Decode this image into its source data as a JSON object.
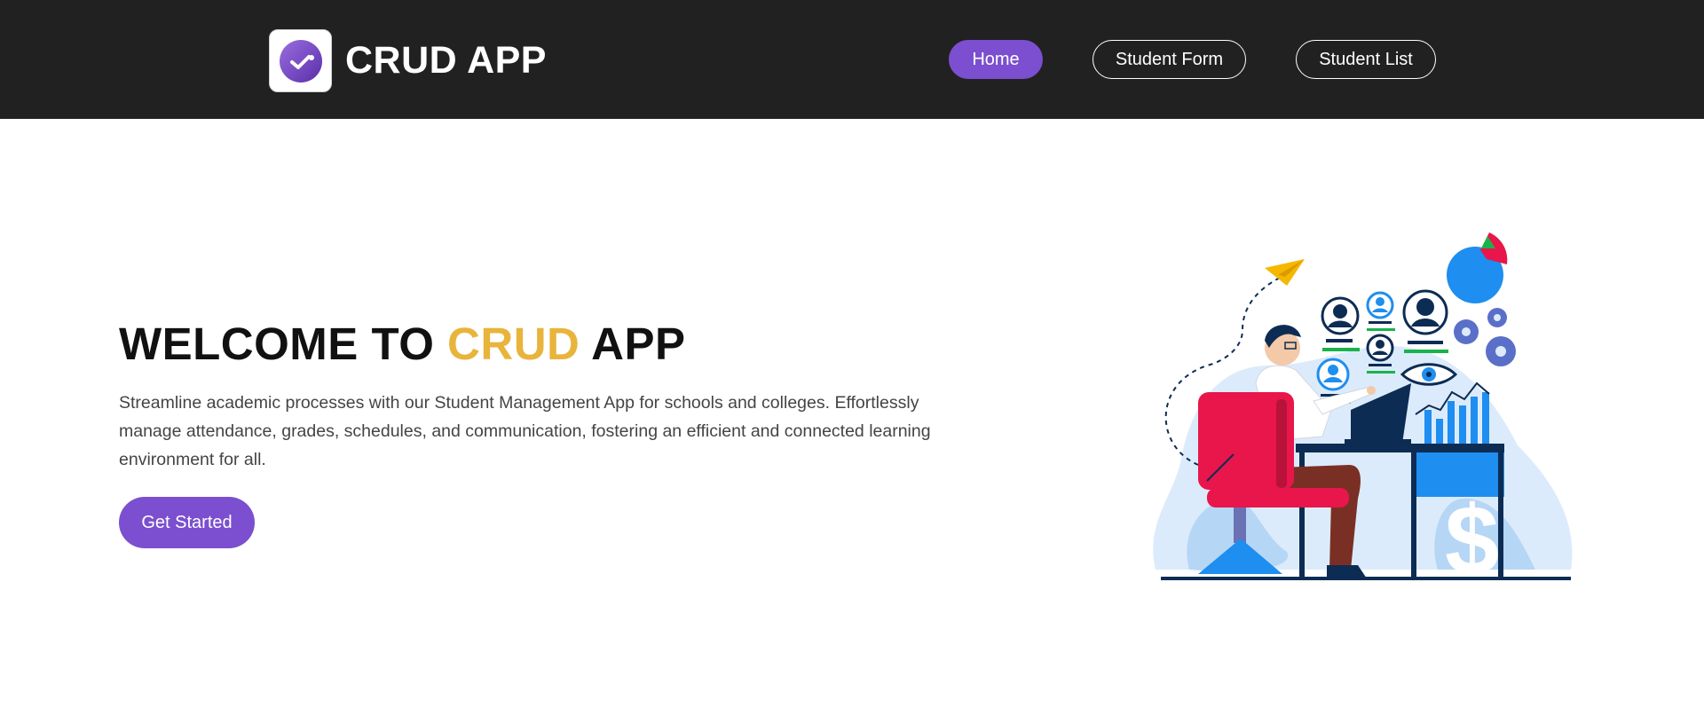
{
  "navbar": {
    "brand": "CRUD APP",
    "links": [
      {
        "label": "Home",
        "active": true
      },
      {
        "label": "Student Form",
        "active": false
      },
      {
        "label": "Student List",
        "active": false
      }
    ]
  },
  "hero": {
    "title_part1": "WELCOME TO ",
    "title_accent": "CRUD",
    "title_part2": " APP",
    "description": "Streamline academic processes with our Student Management App for schools and colleges. Effortlessly manage attendance, grades, schedules, and communication, fostering an efficient and connected learning environment for all.",
    "cta_label": "Get Started"
  },
  "colors": {
    "navbar_bg": "#212121",
    "accent_purple": "#7b4fcf",
    "accent_gold": "#e9b43c"
  },
  "icons": {
    "logo": "app-logo-icon",
    "illustration": "dashboard-analytics-illustration"
  }
}
